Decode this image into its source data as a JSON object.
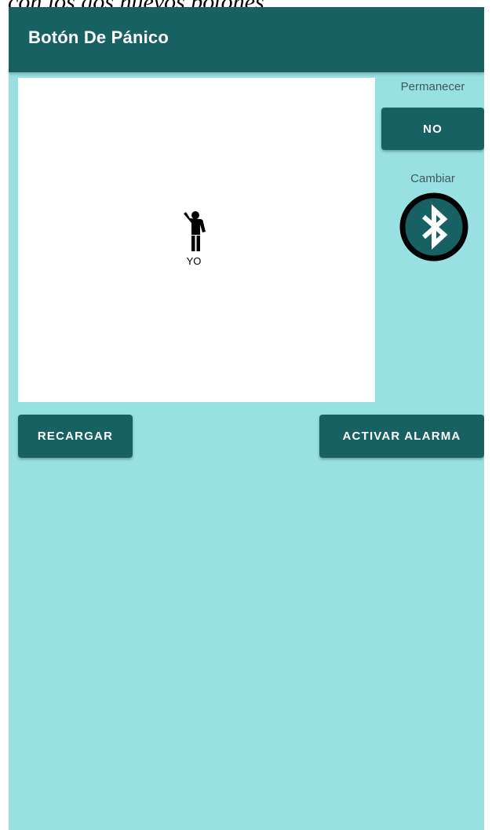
{
  "caption": "con los dos nuevos botones",
  "appbar": {
    "title": "Botón De Pánico"
  },
  "map": {
    "marker_label": "YO",
    "marker_icon": "person-waving-icon"
  },
  "side_panel": {
    "permanecer_label": "Permanecer",
    "permanecer_button": "NO",
    "cambiar_label": "Cambiar",
    "bluetooth_icon": "bluetooth-icon"
  },
  "actions": {
    "reload_label": "RECARGAR",
    "alarm_label": "ACTIVAR ALARMA"
  },
  "colors": {
    "primary": "#186163",
    "background": "#98e0e2",
    "map_bg": "#ffffff"
  }
}
